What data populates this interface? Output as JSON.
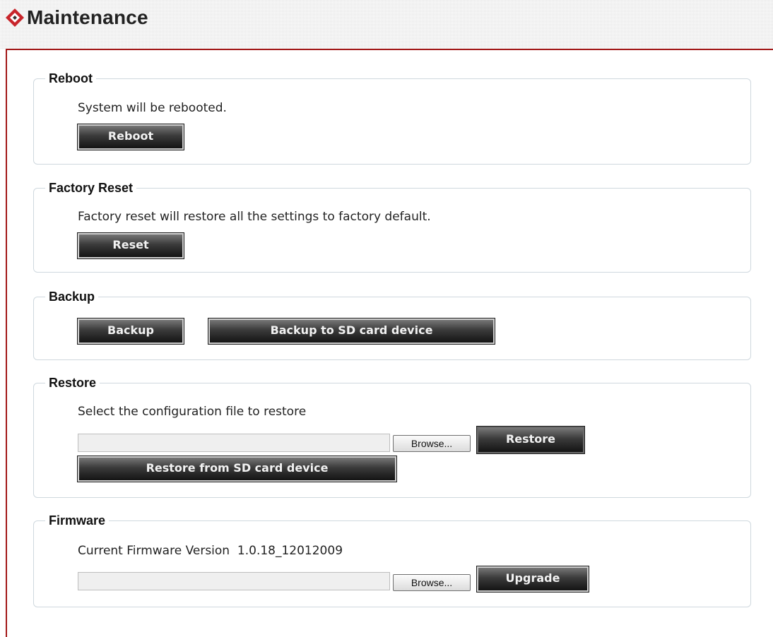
{
  "header": {
    "title": "Maintenance",
    "logo_icon": "red-diamond-logo-icon"
  },
  "reboot": {
    "legend": "Reboot",
    "description": "System will be rebooted.",
    "button": "Reboot"
  },
  "factory_reset": {
    "legend": "Factory Reset",
    "description": "Factory reset will restore all the settings to factory default.",
    "button": "Reset"
  },
  "backup": {
    "legend": "Backup",
    "button": "Backup",
    "sd_button": "Backup to SD card device"
  },
  "restore": {
    "legend": "Restore",
    "description": "Select the configuration file to restore",
    "file_value": "",
    "browse_button": "Browse...",
    "button": "Restore",
    "sd_button": "Restore from SD card device"
  },
  "firmware": {
    "legend": "Firmware",
    "version_label": "Current Firmware Version",
    "version_value": "1.0.18_12012009",
    "file_value": "",
    "browse_button": "Browse...",
    "button": "Upgrade"
  },
  "colors": {
    "frame": "#a31818",
    "button_dark": "#1b1b1b",
    "section_border": "#cfd8de"
  }
}
